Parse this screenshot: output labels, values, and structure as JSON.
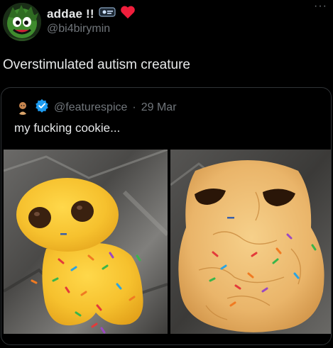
{
  "post": {
    "display_name": "addae !!",
    "handle": "@bi4birymin",
    "more_label": "···",
    "text": "Overstimulated autism creature"
  },
  "quote": {
    "handle": "@featurespice",
    "separator": "·",
    "date": "29 Mar",
    "text": "my fucking cookie..."
  },
  "icons": {
    "badge": "id-card-icon",
    "heart": "red-heart-icon",
    "verified": "verified-badge-icon",
    "avatar": "green-character-avatar",
    "quote_avatar": "cartoon-avatar"
  },
  "colors": {
    "background": "#000000",
    "text": "#e7e9ea",
    "muted": "#71767b",
    "verified": "#1d9bf0",
    "heart": "#f91880",
    "border": "#2f3336"
  }
}
